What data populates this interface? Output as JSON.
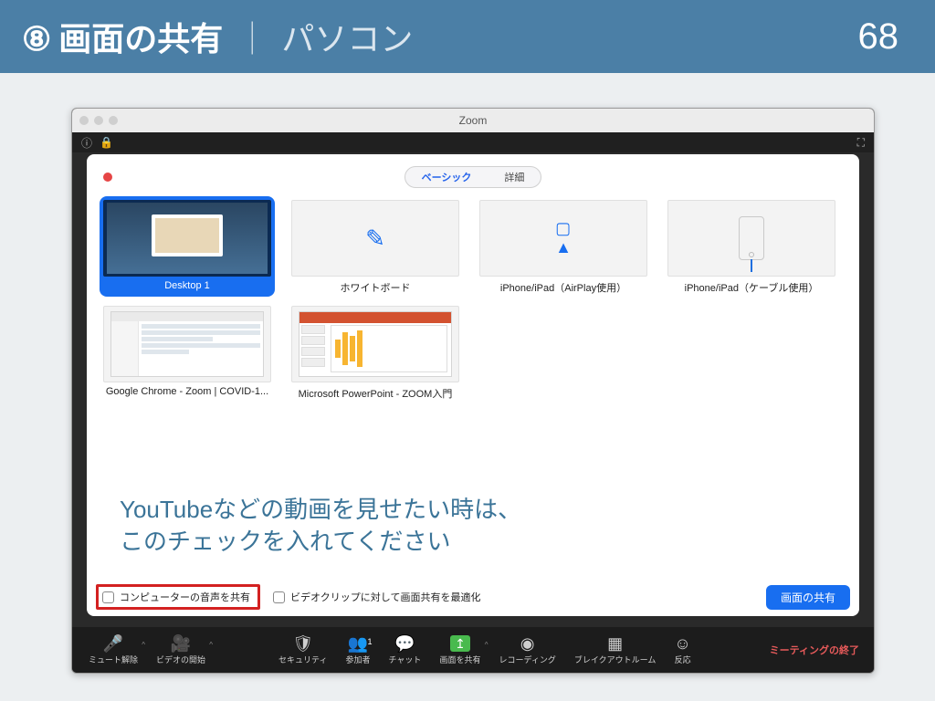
{
  "slide": {
    "number_badge": "⑧",
    "title_main": "画面の共有",
    "divider": "｜",
    "subtitle": "パソコン",
    "page_number": "68"
  },
  "mac": {
    "title": "Zoom"
  },
  "tabs": {
    "basic": "ベーシック",
    "advanced": "詳細"
  },
  "tiles": {
    "desktop": "Desktop 1",
    "whiteboard": "ホワイトボード",
    "airplay": "iPhone/iPad（AirPlay使用）",
    "cable": "iPhone/iPad（ケーブル使用）",
    "chrome": "Google Chrome - Zoom | COVID-1...",
    "ppt": "Microsoft PowerPoint - ZOOM入門"
  },
  "hint": {
    "line1": "YouTubeなどの動画を見せたい時は、",
    "line2": "このチェックを入れてください"
  },
  "options": {
    "share_audio": "コンピューターの音声を共有",
    "optimize_video": "ビデオクリップに対して画面共有を最適化"
  },
  "share_button": "画面の共有",
  "controls": {
    "mute": "ミュート解除",
    "video": "ビデオの開始",
    "security": "セキュリティ",
    "participants": "参加者",
    "participants_count": "1",
    "chat": "チャット",
    "share": "画面を共有",
    "record": "レコーディング",
    "breakout": "ブレイクアウトルーム",
    "reaction": "反応",
    "end": "ミーティングの終了"
  }
}
